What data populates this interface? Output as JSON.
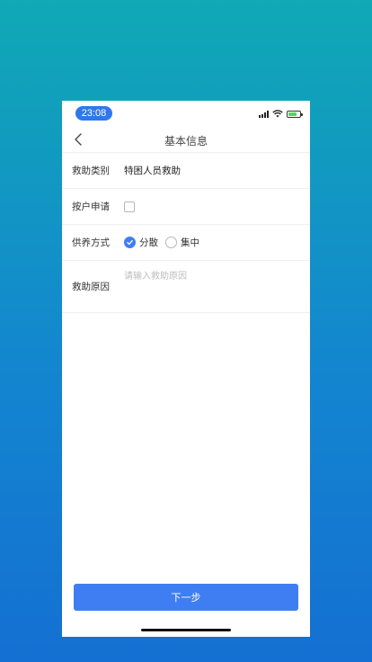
{
  "status_bar": {
    "time": "23:08",
    "icons": [
      "signal-icon",
      "wifi-icon",
      "battery-charging-icon"
    ]
  },
  "nav": {
    "title": "基本信息",
    "back_icon": "chevron-left-icon"
  },
  "form": {
    "category": {
      "label": "救助类别",
      "value": "特困人员救助"
    },
    "household": {
      "label": "按户申请",
      "checked": false
    },
    "support": {
      "label": "供养方式",
      "options": [
        {
          "label": "分散",
          "selected": true
        },
        {
          "label": "集中",
          "selected": false
        }
      ]
    },
    "reason": {
      "label": "救助原因",
      "placeholder": "请输入救助原因",
      "value": ""
    }
  },
  "footer": {
    "next_label": "下一步"
  },
  "colors": {
    "accent": "#3f7ef2",
    "time_pill": "#2f78e8",
    "battery": "#4cd964"
  }
}
